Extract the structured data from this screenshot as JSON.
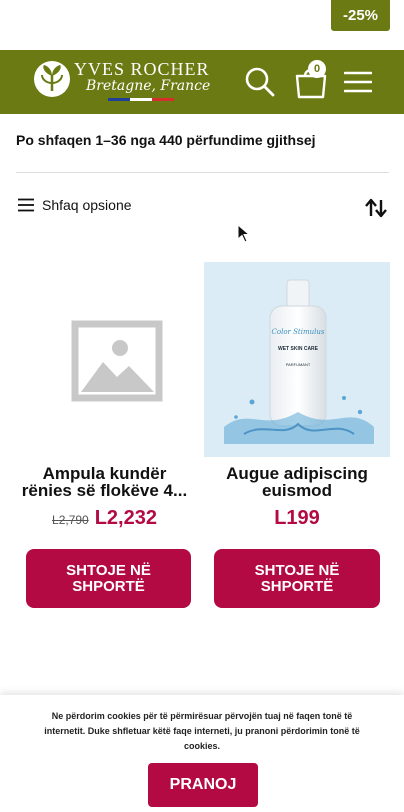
{
  "promo": {
    "discount_badge": "-25%"
  },
  "header": {
    "brand": "YVES ROCHER",
    "brand_sub": "Bretagne, France",
    "cart_count": "0",
    "colors": {
      "bar": "#6b7a12",
      "accent": "#b30a44"
    },
    "icons": [
      "search-icon",
      "cart-icon",
      "hamburger-menu-icon"
    ]
  },
  "listing": {
    "result_count": "Po shfaqen 1–36 nga 440 përfundime gjithsej",
    "options_label": "Shfaq opsione"
  },
  "products": [
    {
      "name": "Ampula kundër rënies së flokëve 4...",
      "old_price": "L2,790",
      "price": "L2,232",
      "image": "placeholder-image-icon",
      "add_label": "SHTOJE NË SHPORTË"
    },
    {
      "name": "Augue adipiscing euismod",
      "old_price": "",
      "price": "L199",
      "image": "shampoo-bottle-photo",
      "image_text": [
        "Color Stimulus",
        "WET SKIN CARE",
        "PARFUMANT"
      ],
      "add_label": "SHTOJE NË SHPORTË"
    }
  ],
  "cookies": {
    "message": "Ne përdorim cookies për të përmirësuar përvojën tuaj në faqen tonë të internetit. Duke shfletuar këtë faqe interneti, ju pranoni përdorimin tonë të cookies.",
    "accept_label": "PRANOJ"
  }
}
